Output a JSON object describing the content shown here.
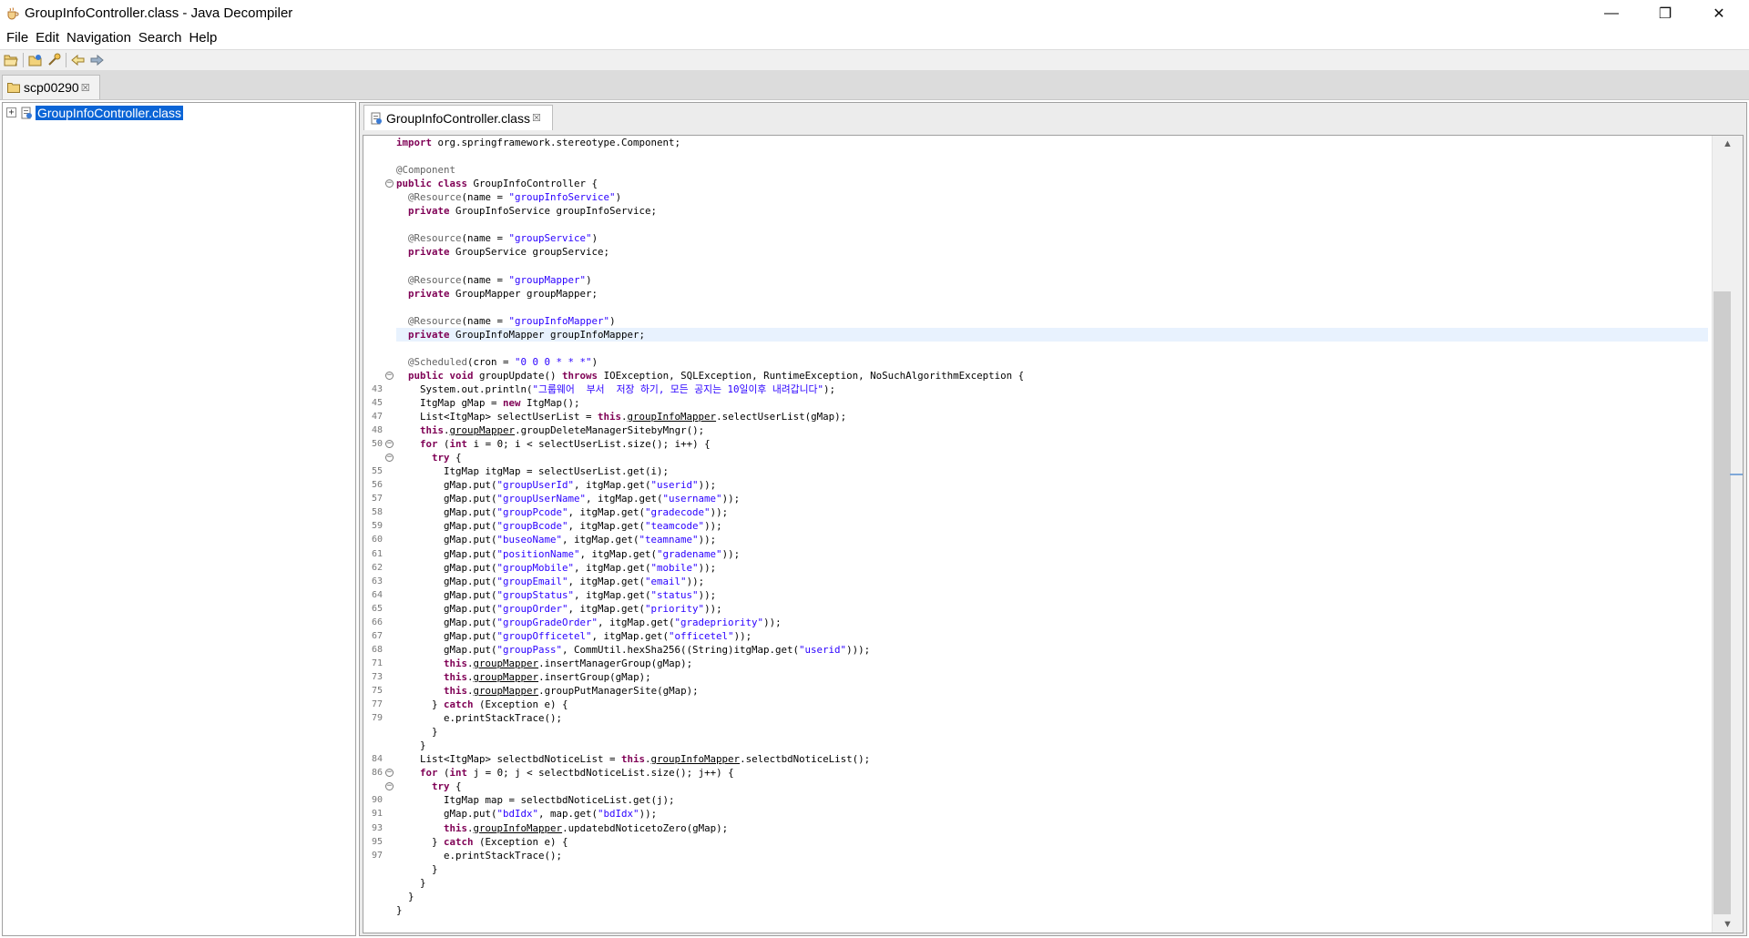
{
  "window": {
    "title": "GroupInfoController.class - Java Decompiler",
    "controls": {
      "minimize": "—",
      "maximize": "❐",
      "close": "✕"
    }
  },
  "menu": [
    "File",
    "Edit",
    "Navigation",
    "Search",
    "Help"
  ],
  "toolbar": {
    "buttons": [
      "open-file-icon",
      "open-type-icon",
      "open-type-hierarchy-icon",
      "back-icon",
      "forward-icon"
    ]
  },
  "archive_tab": {
    "label": "scp00290",
    "close": "☒"
  },
  "tree": {
    "expander": "+",
    "items": [
      {
        "label": "GroupInfoController.class",
        "selected": true
      }
    ]
  },
  "editor": {
    "tab": {
      "label": "GroupInfoController.class",
      "close": "☒"
    },
    "lines": [
      {
        "n": "",
        "fold": "",
        "html": "<span class=\"kw\">import</span> org.springframework.stereotype.Component;"
      },
      {
        "n": "",
        "fold": "",
        "html": ""
      },
      {
        "n": "",
        "fold": "",
        "html": "<span class=\"ann\">@Component</span>"
      },
      {
        "n": "",
        "fold": "⊖",
        "html": "<span class=\"kw\">public class</span> GroupInfoController {"
      },
      {
        "n": "",
        "fold": "",
        "html": "  <span class=\"ann\">@Resource</span>(name = <span class=\"str\">\"groupInfoService\"</span>)"
      },
      {
        "n": "",
        "fold": "",
        "html": "  <span class=\"kw\">private</span> GroupInfoService groupInfoService;"
      },
      {
        "n": "",
        "fold": "",
        "html": ""
      },
      {
        "n": "",
        "fold": "",
        "html": "  <span class=\"ann\">@Resource</span>(name = <span class=\"str\">\"groupService\"</span>)"
      },
      {
        "n": "",
        "fold": "",
        "html": "  <span class=\"kw\">private</span> GroupService groupService;"
      },
      {
        "n": "",
        "fold": "",
        "html": ""
      },
      {
        "n": "",
        "fold": "",
        "html": "  <span class=\"ann\">@Resource</span>(name = <span class=\"str\">\"groupMapper\"</span>)"
      },
      {
        "n": "",
        "fold": "",
        "html": "  <span class=\"kw\">private</span> GroupMapper groupMapper;"
      },
      {
        "n": "",
        "fold": "",
        "html": ""
      },
      {
        "n": "",
        "fold": "",
        "html": "  <span class=\"ann\">@Resource</span>(name = <span class=\"str\">\"groupInfoMapper\"</span>)"
      },
      {
        "n": "",
        "fold": "",
        "hl": true,
        "html": "  <span class=\"kw\">private</span> GroupInfoMapper groupInfoMapper;"
      },
      {
        "n": "",
        "fold": "",
        "html": ""
      },
      {
        "n": "",
        "fold": "",
        "html": "  <span class=\"ann\">@Scheduled</span>(cron = <span class=\"str\">\"0 0 0 * * *\"</span>)"
      },
      {
        "n": "",
        "fold": "⊖",
        "html": "  <span class=\"kw\">public void</span> groupUpdate() <span class=\"kw\">throws</span> IOException, SQLException, RuntimeException, NoSuchAlgorithmException {"
      },
      {
        "n": "43",
        "fold": "",
        "html": "    System.out.println(<span class=\"str\">\"그룹웨어  부서  저장 하기, 모든 공지는 10일이후 내려갑니다\"</span>);"
      },
      {
        "n": "45",
        "fold": "",
        "html": "    ItgMap gMap = <span class=\"kw\">new</span> ItgMap();"
      },
      {
        "n": "47",
        "fold": "",
        "html": "    List&lt;ItgMap&gt; selectUserList = <span class=\"kw\">this</span>.<span class=\"fld\">groupInfoMapper</span>.selectUserList(gMap);"
      },
      {
        "n": "48",
        "fold": "",
        "html": "    <span class=\"kw\">this</span>.<span class=\"fld\">groupMapper</span>.groupDeleteManagerSitebyMngr();"
      },
      {
        "n": "50",
        "fold": "⊖",
        "html": "    <span class=\"kw\">for</span> (<span class=\"kw\">int</span> i = 0; i &lt; selectUserList.size(); i++) {"
      },
      {
        "n": "",
        "fold": "⊖",
        "html": "      <span class=\"kw\">try</span> {"
      },
      {
        "n": "55",
        "fold": "",
        "html": "        ItgMap itgMap = selectUserList.get(i);"
      },
      {
        "n": "56",
        "fold": "",
        "html": "        gMap.put(<span class=\"str\">\"groupUserId\"</span>, itgMap.get(<span class=\"str\">\"userid\"</span>));"
      },
      {
        "n": "57",
        "fold": "",
        "html": "        gMap.put(<span class=\"str\">\"groupUserName\"</span>, itgMap.get(<span class=\"str\">\"username\"</span>));"
      },
      {
        "n": "58",
        "fold": "",
        "html": "        gMap.put(<span class=\"str\">\"groupPcode\"</span>, itgMap.get(<span class=\"str\">\"gradecode\"</span>));"
      },
      {
        "n": "59",
        "fold": "",
        "html": "        gMap.put(<span class=\"str\">\"groupBcode\"</span>, itgMap.get(<span class=\"str\">\"teamcode\"</span>));"
      },
      {
        "n": "60",
        "fold": "",
        "html": "        gMap.put(<span class=\"str\">\"buseoName\"</span>, itgMap.get(<span class=\"str\">\"teamname\"</span>));"
      },
      {
        "n": "61",
        "fold": "",
        "html": "        gMap.put(<span class=\"str\">\"positionName\"</span>, itgMap.get(<span class=\"str\">\"gradename\"</span>));"
      },
      {
        "n": "62",
        "fold": "",
        "html": "        gMap.put(<span class=\"str\">\"groupMobile\"</span>, itgMap.get(<span class=\"str\">\"mobile\"</span>));"
      },
      {
        "n": "63",
        "fold": "",
        "html": "        gMap.put(<span class=\"str\">\"groupEmail\"</span>, itgMap.get(<span class=\"str\">\"email\"</span>));"
      },
      {
        "n": "64",
        "fold": "",
        "html": "        gMap.put(<span class=\"str\">\"groupStatus\"</span>, itgMap.get(<span class=\"str\">\"status\"</span>));"
      },
      {
        "n": "65",
        "fold": "",
        "html": "        gMap.put(<span class=\"str\">\"groupOrder\"</span>, itgMap.get(<span class=\"str\">\"priority\"</span>));"
      },
      {
        "n": "66",
        "fold": "",
        "html": "        gMap.put(<span class=\"str\">\"groupGradeOrder\"</span>, itgMap.get(<span class=\"str\">\"gradepriority\"</span>));"
      },
      {
        "n": "67",
        "fold": "",
        "html": "        gMap.put(<span class=\"str\">\"groupOfficetel\"</span>, itgMap.get(<span class=\"str\">\"officetel\"</span>));"
      },
      {
        "n": "68",
        "fold": "",
        "html": "        gMap.put(<span class=\"str\">\"groupPass\"</span>, CommUtil.hexSha256((String)itgMap.get(<span class=\"str\">\"userid\"</span>)));"
      },
      {
        "n": "71",
        "fold": "",
        "html": "        <span class=\"kw\">this</span>.<span class=\"fld\">groupMapper</span>.insertManagerGroup(gMap);"
      },
      {
        "n": "73",
        "fold": "",
        "html": "        <span class=\"kw\">this</span>.<span class=\"fld\">groupMapper</span>.insertGroup(gMap);"
      },
      {
        "n": "75",
        "fold": "",
        "html": "        <span class=\"kw\">this</span>.<span class=\"fld\">groupMapper</span>.groupPutManagerSite(gMap);"
      },
      {
        "n": "77",
        "fold": "",
        "html": "      } <span class=\"kw\">catch</span> (Exception e) {"
      },
      {
        "n": "79",
        "fold": "",
        "html": "        e.printStackTrace();"
      },
      {
        "n": "",
        "fold": "",
        "html": "      }"
      },
      {
        "n": "",
        "fold": "",
        "html": "    }"
      },
      {
        "n": "84",
        "fold": "",
        "html": "    List&lt;ItgMap&gt; selectbdNoticeList = <span class=\"kw\">this</span>.<span class=\"fld\">groupInfoMapper</span>.selectbdNoticeList();"
      },
      {
        "n": "86",
        "fold": "⊖",
        "html": "    <span class=\"kw\">for</span> (<span class=\"kw\">int</span> j = 0; j &lt; selectbdNoticeList.size(); j++) {"
      },
      {
        "n": "",
        "fold": "⊖",
        "html": "      <span class=\"kw\">try</span> {"
      },
      {
        "n": "90",
        "fold": "",
        "html": "        ItgMap map = selectbdNoticeList.get(j);"
      },
      {
        "n": "91",
        "fold": "",
        "html": "        gMap.put(<span class=\"str\">\"bdIdx\"</span>, map.get(<span class=\"str\">\"bdIdx\"</span>));"
      },
      {
        "n": "93",
        "fold": "",
        "html": "        <span class=\"kw\">this</span>.<span class=\"fld\">groupInfoMapper</span>.updatebdNoticetoZero(gMap);"
      },
      {
        "n": "95",
        "fold": "",
        "html": "      } <span class=\"kw\">catch</span> (Exception e) {"
      },
      {
        "n": "97",
        "fold": "",
        "html": "        e.printStackTrace();"
      },
      {
        "n": "",
        "fold": "",
        "html": "      }"
      },
      {
        "n": "",
        "fold": "",
        "html": "    }"
      },
      {
        "n": "",
        "fold": "",
        "html": "  }"
      },
      {
        "n": "",
        "fold": "",
        "html": "}"
      }
    ]
  },
  "colors": {
    "keyword": "#7f0055",
    "string": "#2a00ff",
    "annotation": "#646464",
    "selection": "#0a64d6",
    "current_line": "#e8f2fe"
  }
}
